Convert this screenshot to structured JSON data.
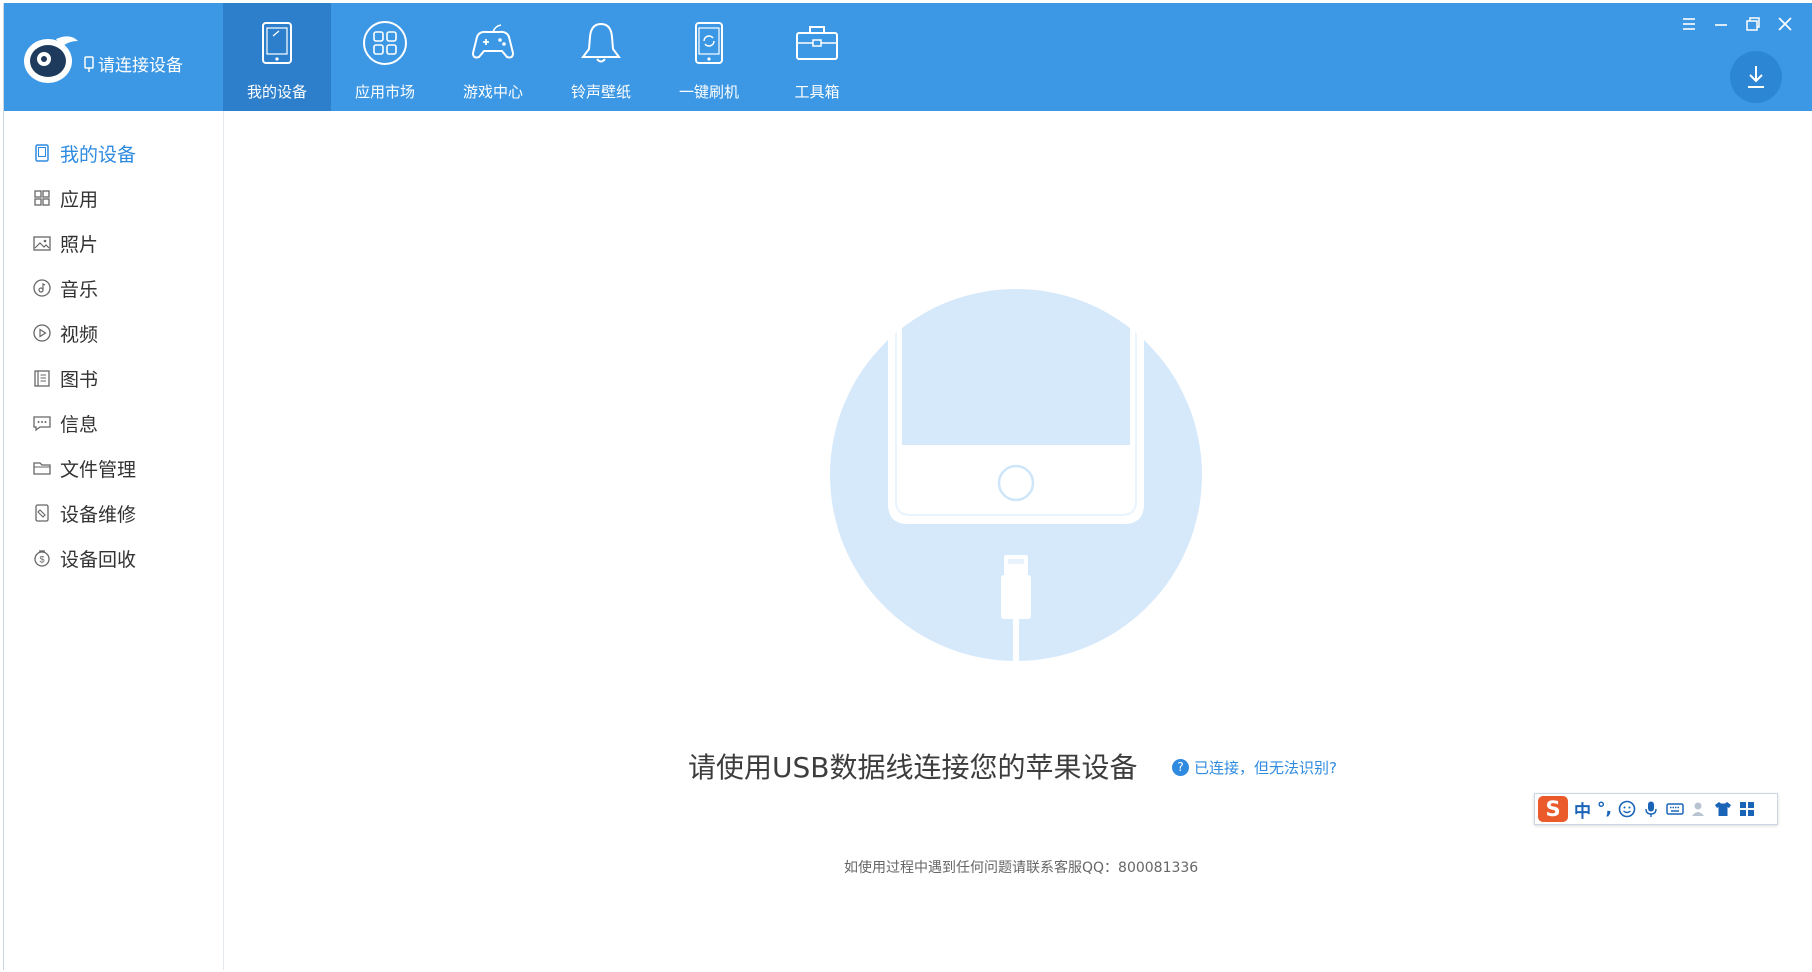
{
  "header": {
    "connect_label": "请连接设备",
    "tabs": [
      {
        "label": "我的设备",
        "icon": "tablet-icon",
        "active": true
      },
      {
        "label": "应用市场",
        "icon": "apps-grid-icon",
        "active": false
      },
      {
        "label": "游戏中心",
        "icon": "gamepad-icon",
        "active": false
      },
      {
        "label": "铃声壁纸",
        "icon": "bell-icon",
        "active": false
      },
      {
        "label": "一键刷机",
        "icon": "phone-refresh-icon",
        "active": false
      },
      {
        "label": "工具箱",
        "icon": "toolbox-icon",
        "active": false
      }
    ]
  },
  "sidebar": {
    "items": [
      {
        "label": "我的设备",
        "icon": "device-icon",
        "active": true
      },
      {
        "label": "应用",
        "icon": "grid-icon"
      },
      {
        "label": "照片",
        "icon": "image-icon"
      },
      {
        "label": "音乐",
        "icon": "music-icon"
      },
      {
        "label": "视频",
        "icon": "play-icon"
      },
      {
        "label": "图书",
        "icon": "book-icon"
      },
      {
        "label": "信息",
        "icon": "message-icon"
      },
      {
        "label": "文件管理",
        "icon": "folder-icon"
      },
      {
        "label": "设备维修",
        "icon": "repair-icon"
      },
      {
        "label": "设备回收",
        "icon": "recycle-money-icon"
      }
    ]
  },
  "main": {
    "prompt": "请使用USB数据线连接您的苹果设备",
    "help_link": "已连接，但无法识别?",
    "help_icon_text": "?",
    "footer_note": "如使用过程中遇到任何问题请联系客服QQ：800081336"
  },
  "ime": {
    "logo_letter": "S",
    "mode_char": "中",
    "punct": "°,"
  },
  "colors": {
    "topbar": "#3c97e4",
    "active_tab": "#2e7fcb",
    "accent": "#2f8be0",
    "hero_circle": "#d5e9fb"
  }
}
